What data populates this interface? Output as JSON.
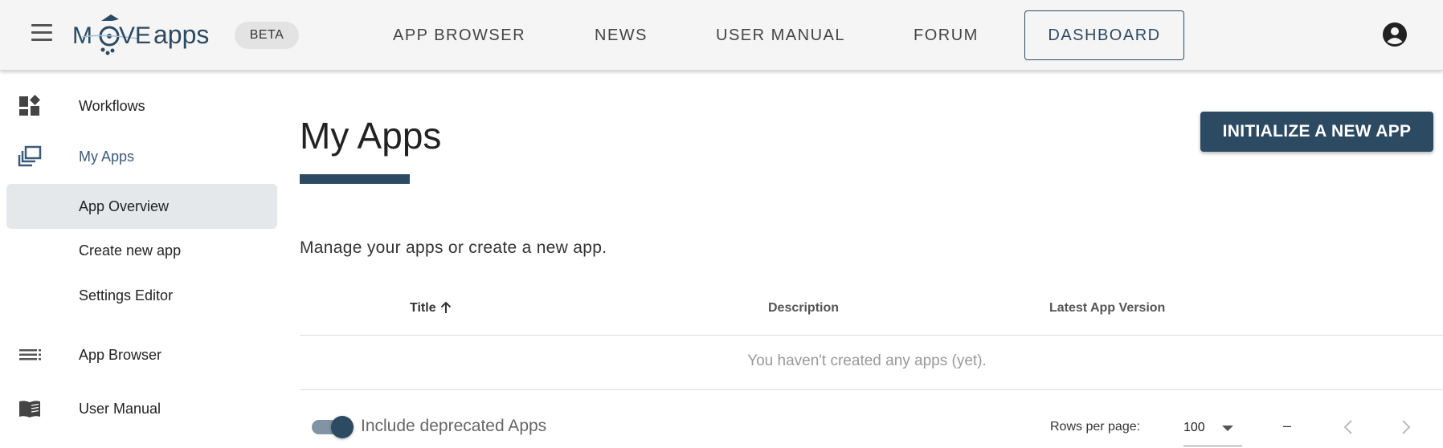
{
  "header": {
    "logo": {
      "text_pre": "M",
      "text_mid": "VE",
      "text_post": "apps"
    },
    "beta_badge": "BETA",
    "nav": {
      "app_browser": "APP BROWSER",
      "news": "NEWS",
      "user_manual": "USER MANUAL",
      "forum": "FORUM",
      "dashboard": "DASHBOARD"
    }
  },
  "sidebar": {
    "items": [
      {
        "label": "Workflows",
        "icon": "dashboard-icon"
      },
      {
        "label": "My Apps",
        "icon": "library-icon"
      },
      {
        "label": "App Overview"
      },
      {
        "label": "Create new app"
      },
      {
        "label": "Settings Editor"
      },
      {
        "label": "App Browser",
        "icon": "list-icon"
      },
      {
        "label": "User Manual",
        "icon": "book-icon"
      }
    ]
  },
  "main": {
    "title": "My Apps",
    "init_button": "INITIALIZE A NEW APP",
    "subtitle": "Manage your apps or create a new app.",
    "table": {
      "columns": {
        "title": "Title",
        "description": "Description",
        "version": "Latest App Version"
      },
      "empty_message": "You haven't created any apps (yet)."
    },
    "footer": {
      "toggle_label": "Include deprecated Apps",
      "toggle_on": true,
      "rows_per_page_label": "Rows per page:",
      "rows_per_page_value": "100",
      "range": "–"
    }
  },
  "colors": {
    "accent": "#2d4a63",
    "sidebar_active": "#e4e8eb",
    "topbar_bg": "#f5f5f5"
  }
}
